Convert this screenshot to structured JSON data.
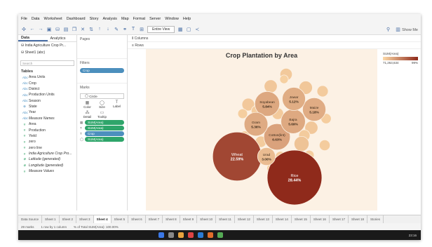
{
  "menu": [
    "File",
    "Data",
    "Worksheet",
    "Dashboard",
    "Story",
    "Analysis",
    "Map",
    "Format",
    "Server",
    "Window",
    "Help"
  ],
  "toolbar": {
    "view_select": "Entire View",
    "show_me": "Show Me"
  },
  "data_pane": {
    "tabs": [
      "Data",
      "Analytics"
    ],
    "sources": [
      "India Agriculture Crop Pr...",
      "Sheet1 (abc)"
    ],
    "search_placeholder": "Search",
    "tables_label": "Tables",
    "fields": [
      {
        "name": "Area Units",
        "kind": "dim",
        "glyph": "Abc"
      },
      {
        "name": "Crop",
        "kind": "dim",
        "glyph": "Abc"
      },
      {
        "name": "District",
        "kind": "dim",
        "glyph": "Abc"
      },
      {
        "name": "Production Units",
        "kind": "dim",
        "glyph": "Abc"
      },
      {
        "name": "Season",
        "kind": "dim",
        "glyph": "Abc"
      },
      {
        "name": "State",
        "kind": "dim",
        "glyph": "⊕"
      },
      {
        "name": "Year",
        "kind": "dim",
        "glyph": "Abc"
      },
      {
        "name": "Measure Names",
        "kind": "dim",
        "glyph": "Abc",
        "italic": true
      },
      {
        "name": "Area",
        "kind": "meas",
        "glyph": "#"
      },
      {
        "name": "Production",
        "kind": "meas",
        "glyph": "#"
      },
      {
        "name": "Yield",
        "kind": "meas",
        "glyph": "#"
      },
      {
        "name": "zero",
        "kind": "meas",
        "glyph": "#"
      },
      {
        "name": "zero line",
        "kind": "meas",
        "glyph": "#"
      },
      {
        "name": "India Agriculture Crop Pro...",
        "kind": "meas",
        "glyph": "#",
        "italic": true
      },
      {
        "name": "Latitude (generated)",
        "kind": "meas",
        "glyph": "⊕",
        "italic": true
      },
      {
        "name": "Longitude (generated)",
        "kind": "meas",
        "glyph": "⊕",
        "italic": true
      },
      {
        "name": "Measure Values",
        "kind": "meas",
        "glyph": "#",
        "italic": true
      }
    ]
  },
  "shelves": {
    "pages_label": "Pages",
    "filters_label": "Filters",
    "filter_pill": "Crop",
    "marks_label": "Marks",
    "mark_type": "Circle",
    "mark_buttons": [
      {
        "label": "Color",
        "glyph": "▦"
      },
      {
        "label": "Size",
        "glyph": "◯"
      },
      {
        "label": "Label",
        "glyph": "T"
      },
      {
        "label": "Detail",
        "glyph": "⁂"
      },
      {
        "label": "Tooltip",
        "glyph": "▭"
      }
    ],
    "mark_pills": [
      {
        "icon": "▦",
        "label": "SUM(Area)",
        "color": "green"
      },
      {
        "icon": "T",
        "label": "SUM(Area)",
        "color": "green"
      },
      {
        "icon": "T",
        "label": "Crop",
        "color": "blue"
      },
      {
        "icon": "◯",
        "label": "SUM(Area)",
        "color": "green"
      }
    ],
    "columns_label": "Columns",
    "rows_label": "Rows"
  },
  "legend": {
    "title": "SUM(Area)",
    "min": "71,263,634",
    "max": "99%"
  },
  "chart_data": {
    "type": "packed-bubble",
    "title": "Crop Plantation by Area",
    "measure": "SUM(Area)",
    "color_range": [
      "#fcd9a8",
      "#8f2a1b"
    ],
    "labeled": [
      {
        "name": "Rice",
        "value": 28.44
      },
      {
        "name": "Wheat",
        "value": 22.59
      },
      {
        "name": "Cotton(lint)",
        "value": 6.63
      },
      {
        "name": "Soyabean",
        "value": 5.84
      },
      {
        "name": "Bajra",
        "value": 5.69
      },
      {
        "name": "Gram",
        "value": 5.36
      },
      {
        "name": "Maize",
        "value": 5.18
      },
      {
        "name": "Jowar",
        "value": 5.12
      },
      {
        "name": "Urad",
        "value": 3.0
      }
    ],
    "other_count": 20,
    "value_format": "%"
  },
  "sheet_tabs": [
    "Data Source",
    "Sheet 1",
    "Sheet 2",
    "Sheet 3",
    "Sheet 4",
    "Sheet 5",
    "Sheet 6",
    "Sheet 7",
    "Sheet 8",
    "Sheet 9",
    "Sheet 10",
    "Sheet 11",
    "Sheet 12",
    "Sheet 13",
    "Sheet 14",
    "Sheet 15",
    "Sheet 16",
    "Sheet 17",
    "Sheet 18",
    "Stories"
  ],
  "active_sheet": "Sheet 4",
  "status": {
    "marks": "29 marks",
    "rows_cols": "1 row by 1 column",
    "total": "% of Total SUM(Area): 100.00%"
  },
  "clock": "23:16"
}
